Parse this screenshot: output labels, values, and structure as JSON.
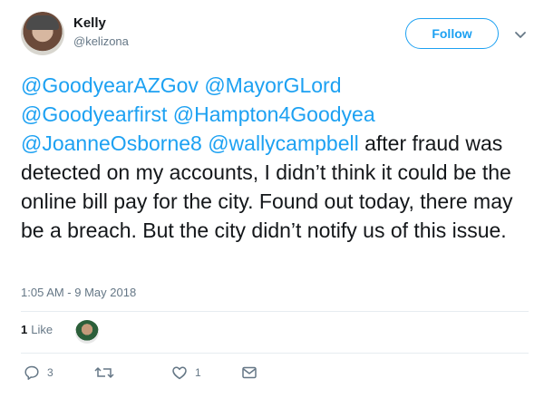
{
  "user": {
    "name": "Kelly",
    "handle": "@kelizona"
  },
  "header": {
    "follow_label": "Follow",
    "more_icon": "chevron-down-icon"
  },
  "tweet": {
    "mentions": [
      "@GoodyearAZGov",
      "@MayorGLord",
      "@Goodyearfirst",
      "@Hampton4Goodyea",
      "@JoanneOsborne8",
      "@wallycampbell"
    ],
    "body": "after fraud was detected on my accounts, I didn’t think it could be the online bill pay for the city. Found out today, there may be a breach. But the city didn’t notify us of this issue.",
    "timestamp": "1:05 AM - 9 May 2018"
  },
  "likes": {
    "count": "1",
    "label": "Like"
  },
  "actions": {
    "reply_count": "3",
    "retweet_count": "",
    "like_count": "1",
    "reply_icon": "reply-icon",
    "retweet_icon": "retweet-icon",
    "like_icon": "heart-icon",
    "dm_icon": "envelope-icon"
  },
  "colors": {
    "link": "#1da1f2",
    "secondary_text": "#657786",
    "divider": "#e6ecf0"
  }
}
